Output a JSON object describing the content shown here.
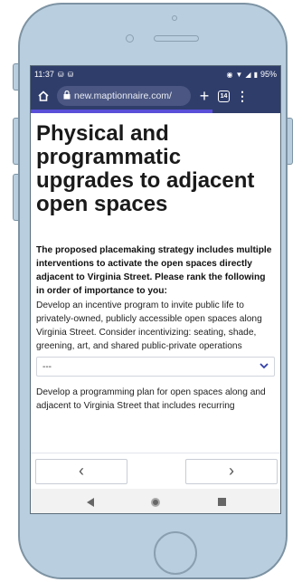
{
  "status_bar": {
    "time": "11:37",
    "battery": "95%",
    "notification_icons": [
      "notification-icon",
      "notification-icon"
    ]
  },
  "browser": {
    "url": "new.maptionnaire.com/",
    "tab_count": "14"
  },
  "progress": {
    "fraction": 0.73,
    "color": "#5a4fd8"
  },
  "page": {
    "title": "Physical and programmatic upgrades to adjacent open spaces",
    "prompt": "The proposed placemaking strategy includes multiple interventions to activate the open spaces directly adjacent to Virginia Street. Please rank the following in order of importance to you:",
    "items": [
      {
        "text": "Develop an incentive program to invite public life to privately-owned, publicly accessible open spaces along Virginia Street. Consider incentivizing: seating, shade, greening, art, and shared public-private operations",
        "select_value": "---"
      },
      {
        "text": "Develop a programming plan for open spaces along and adjacent to Virginia Street that includes recurring"
      }
    ]
  },
  "nav": {
    "prev_symbol": "‹",
    "next_symbol": "›"
  },
  "colors": {
    "browser_bar": "#2f3d6b",
    "accent": "#3340a8"
  }
}
